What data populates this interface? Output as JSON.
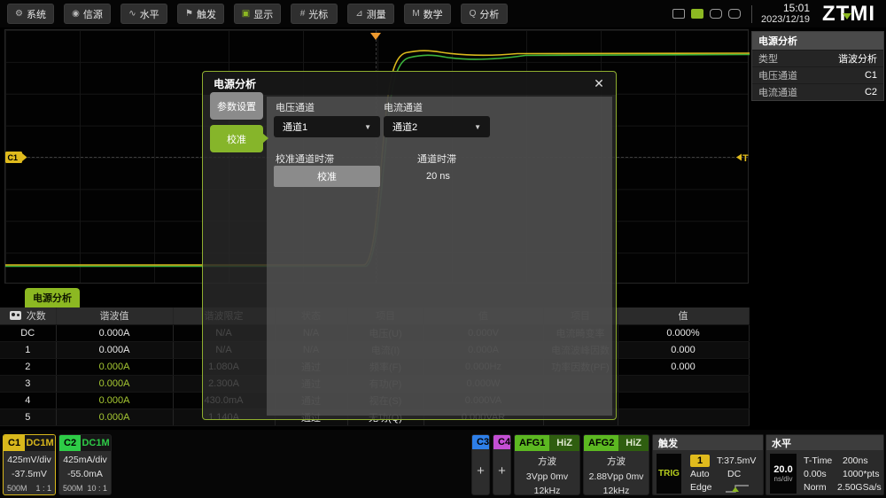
{
  "toolbar": {
    "buttons": [
      {
        "label": "系统",
        "icon": "gear-icon",
        "glyph": "⚙"
      },
      {
        "label": "信源",
        "icon": "source-icon",
        "glyph": "◉"
      },
      {
        "label": "水平",
        "icon": "horizontal-icon",
        "glyph": "∿"
      },
      {
        "label": "触发",
        "icon": "trigger-flag-icon",
        "glyph": "⚑"
      },
      {
        "label": "显示",
        "icon": "display-icon",
        "glyph": "▣"
      },
      {
        "label": "光标",
        "icon": "cursor-icon",
        "glyph": "#"
      },
      {
        "label": "测量",
        "icon": "measure-icon",
        "glyph": "⊿"
      },
      {
        "label": "数学",
        "icon": "math-icon",
        "glyph": "M"
      },
      {
        "label": "分析",
        "icon": "analyze-icon",
        "glyph": "Q"
      }
    ],
    "clock": {
      "time": "15:01",
      "date": "2023/12/19"
    },
    "logo": "ZTMI"
  },
  "right_panel": {
    "title": "电源分析",
    "rows": [
      {
        "label": "类型",
        "value": "谐波分析"
      },
      {
        "label": "电压通道",
        "value": "C1"
      },
      {
        "label": "电流通道",
        "value": "C2"
      }
    ]
  },
  "plot": {
    "c1_label": "C1",
    "t_label": "T"
  },
  "dialog": {
    "title": "电源分析",
    "close": "✕",
    "tabs": [
      {
        "label": "参数设置"
      },
      {
        "label": "校准"
      }
    ],
    "voltage_label": "电压通道",
    "voltage_value": "通道1",
    "current_label": "电流通道",
    "current_value": "通道2",
    "caret": "▼",
    "deskew_cal_label": "校准通道时滞",
    "cal_button": "校准",
    "deskew_label": "通道时滞",
    "deskew_value": "20 ns"
  },
  "table": {
    "tab": "电源分析",
    "headers": [
      "次数",
      "谐波值",
      "谐波限定",
      "状态",
      "项目",
      "值",
      "项目",
      "值"
    ],
    "rows": [
      [
        "DC",
        "0.000A",
        "N/A",
        "N/A",
        "电压(U)",
        "0.000V",
        "电流畸变率",
        "0.000%"
      ],
      [
        "1",
        "0.000A",
        "N/A",
        "N/A",
        "电流(I)",
        "0.000A",
        "电流波峰因数",
        "0.000"
      ],
      [
        "2",
        "0.000A",
        "1.080A",
        "通过",
        "频率(F)",
        "0.000Hz",
        "功率因数(PF)",
        "0.000"
      ],
      [
        "3",
        "0.000A",
        "2.300A",
        "通过",
        "有功(P)",
        "0.000W",
        "",
        ""
      ],
      [
        "4",
        "0.000A",
        "430.0mA",
        "通过",
        "视在(S)",
        "0.000VA",
        "",
        ""
      ],
      [
        "5",
        "0.000A",
        "1.140A",
        "通过",
        "无功(Q)",
        "0.000VAR",
        "",
        ""
      ]
    ]
  },
  "channels": {
    "c1": {
      "name": "C1",
      "coupling": "DC1M",
      "scale": "425mV/div",
      "offset": "-37.5mV",
      "bw": "500M",
      "ratio": "1 : 1"
    },
    "c2": {
      "name": "C2",
      "coupling": "DC1M",
      "scale": "425mA/div",
      "offset": "-55.0mA",
      "bw": "500M",
      "ratio": "10 : 1"
    },
    "c3": {
      "name": "C3",
      "plus": "+"
    },
    "c4": {
      "name": "C4",
      "plus": "+"
    }
  },
  "afg": {
    "afg1": {
      "name": "AFG1",
      "imp": "HiZ",
      "wave": "方波",
      "amp": "3Vpp  0mv",
      "freq": "12kHz"
    },
    "afg2": {
      "name": "AFG2",
      "imp": "HiZ",
      "wave": "方波",
      "amp": "2.88Vpp  0mv",
      "freq": "12kHz"
    }
  },
  "trigger": {
    "title": "触发",
    "trig": "TRIG",
    "source": "1",
    "level": "T:37.5mV",
    "mode": "Auto",
    "coupling": "DC",
    "type": "Edge"
  },
  "horizontal": {
    "title": "水平",
    "scale_num": "20.0",
    "scale_unit": "ns/div",
    "t_time_label": "T-Time",
    "t_time": "200ns",
    "delay": "0.00s",
    "pts": "1000*pts",
    "mode": "Norm",
    "rate": "2.50GSa/s"
  },
  "colors": {
    "c1_trace": "#d9b81c",
    "c2_trace": "#3cb43c",
    "accent_green": "#8cb822",
    "orange": "#ef9a2e",
    "cyan": "#35b4e8",
    "dialog_border": "#8fae2f"
  }
}
